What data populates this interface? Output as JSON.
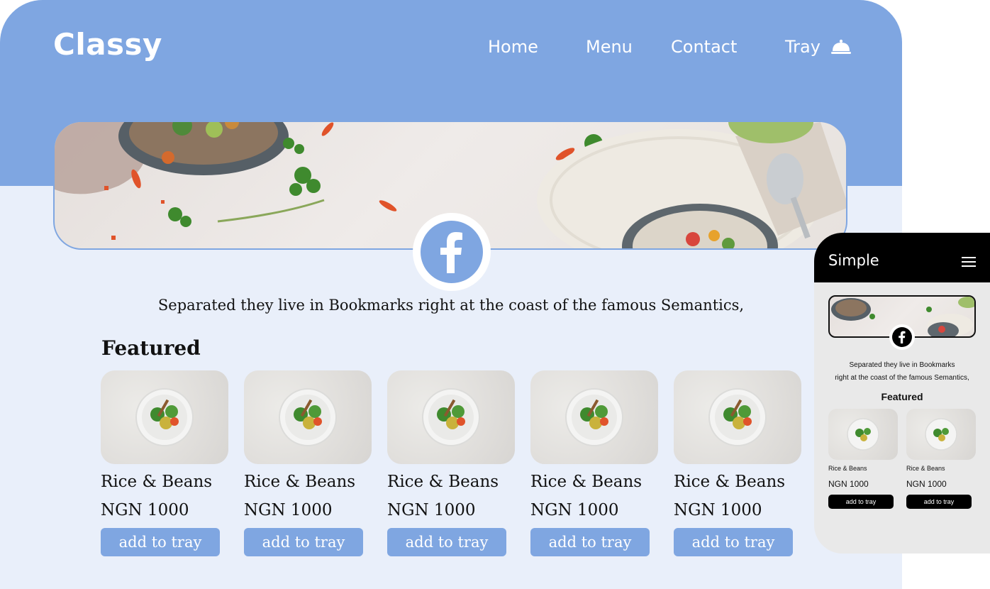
{
  "desktop": {
    "brand": "Classy",
    "nav": {
      "home": "Home",
      "menu": "Menu",
      "contact": "Contact",
      "tray": "Tray"
    },
    "tagline": "Separated they live in Bookmarks right at the coast of the famous Semantics,",
    "featured_title": "Featured",
    "cards": [
      {
        "name": "Rice & Beans",
        "price": "NGN 1000",
        "button": "add to tray"
      },
      {
        "name": "Rice & Beans",
        "price": "NGN 1000",
        "button": "add to tray"
      },
      {
        "name": "Rice & Beans",
        "price": "NGN 1000",
        "button": "add to tray"
      },
      {
        "name": "Rice & Beans",
        "price": "NGN 1000",
        "button": "add to tray"
      },
      {
        "name": "Rice & Beans",
        "price": "NGN 1000",
        "button": "add to tray"
      }
    ]
  },
  "mobile": {
    "brand": "Simple",
    "tagline_line1": "Separated they live in Bookmarks",
    "tagline_line2": "right at the coast of the famous Semantics,",
    "featured_title": "Featured",
    "cards": [
      {
        "name": "Rice & Beans",
        "price": "NGN 1000",
        "button": "add to tray"
      },
      {
        "name": "Rice & Beans",
        "price": "NGN 1000",
        "button": "add to tray"
      }
    ]
  },
  "colors": {
    "accent": "#7fa6e1",
    "page_bg": "#e9effa",
    "mobile_bar": "#000000"
  },
  "icons": [
    "tray-cloche-icon",
    "facebook-icon",
    "hamburger-menu-icon",
    "food-plate-image"
  ]
}
